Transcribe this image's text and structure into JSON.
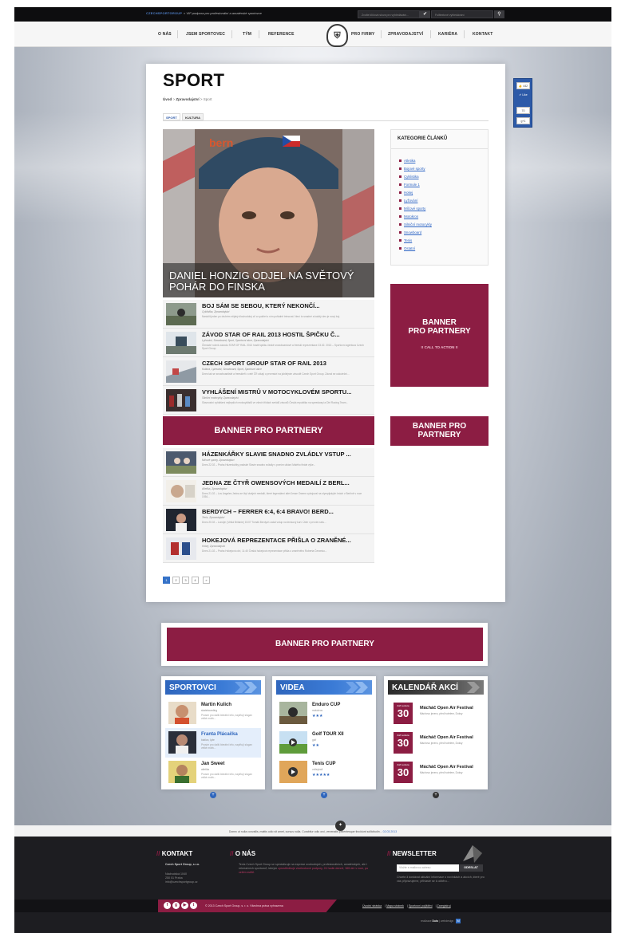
{
  "topbar": {
    "brand": "CZECHSPORTGROUP",
    "tagline": "» VIP podpora pro profesionální a amatérské sportovce",
    "search_placeholder": "Zvolte klíčová slova pro vyhledávání...",
    "search_placeholder2": "Fulltextové vyhledávání"
  },
  "nav": {
    "left": [
      "O NÁS",
      "JSEM SPORTOVEC",
      "TÝM",
      "REFERENCE"
    ],
    "right": [
      "PRO FIRMY",
      "ZPRAVODAJSTVÍ",
      "KARIÉRA",
      "KONTAKT"
    ]
  },
  "page": {
    "title": "SPORT",
    "breadcrumb": [
      "Úvod",
      "Zpravodajství",
      "Sport"
    ],
    "tabs": [
      "SPORT",
      "KULTURA"
    ]
  },
  "featured": {
    "title": "DANIEL HONZIG ODJEL NA SVĚTOVÝ POHÁR DO FINSKA"
  },
  "articles": [
    {
      "title": "BOJ SÁM SE SEBOU, KTERÝ NEKONČÍ...",
      "meta": "Cyklistika, Zpravodajství",
      "desc": "Nastolit jeden po druhém nějaký dlouhodobý cíl a vydržet s ním pořádně trénovat. Není to snadné a každý den je nový boj."
    },
    {
      "title": "ZÁVOD STAR OF RAIL 2013 HOSTIL ŠPIČKU Č...",
      "meta": "Lyžování, Snowboard, Sport, Sportovní akce, Zpravodajství",
      "desc": "Čtrnácté ročník závodu STAR OF RAIL 2013 hostil špičku české snowboardové a freeski reprezentace 23.02. 2013 – Sportovní agentura Czech Sport Group"
    },
    {
      "title": "CZECH SPORT GROUP STAR OF RAIL 2013",
      "meta": "Kultura, Lyžování, Snowboard, Sport, Sportovní akce",
      "desc": "Dnes tak se snowboardisté a freeskieři z celé ČR utkají o prvenství na jubilejním závodě Czech Sport Group. Závod se uskuteční..."
    },
    {
      "title": "VYHLÁŠENÍ MISTRŮ V MOTOCYKLOVÉM SPORTU...",
      "meta": "Silniční motocykly, Zpravodajství",
      "desc": "Slavnostní vyhlášení nejlepších motocyklistů ve všech třídách seriálů závodů Česká republika na speedwayi a Dirt Racing Team..."
    },
    {
      "title": "HÁZENKÁŘKY SLAVIE SNADNO ZVLÁDLY VSTUP ...",
      "meta": "Míčové sporty, Zpravodajství",
      "desc": "Dnes 22.02 – Praha Házenkářky pražské Slavie snadno zvládly v prvním utkání Malého finále výše..."
    },
    {
      "title": "JEDNA ZE ČTYŘ OWENSOVÝCH MEDAILÍ Z BERL...",
      "meta": "Atletika, Zpravodajství",
      "desc": "Dnes 21.02 – Los Angeles Jedna ze čtyř zlatých medailí, které legendární atlet Jesse Owens vybojoval na olympijských hrách v Berlíně v roce 1936..."
    },
    {
      "title": "BERDYCH – FERRER 6:4, 6:4 BRAVO! BERD...",
      "meta": "Tenis, Zpravodajství",
      "desc": "Dnes 20.02 – Londýn (Velká Británie) 15:07 Tomáš Berdych začal vstup na tenisový kurt. Úder v prvním setu..."
    },
    {
      "title": "HOKEJOVÁ REPREZENTACE PŘIŠLA O ZRANĚNÉ...",
      "meta": "Hokej, Zpravodajství",
      "desc": "Dnes 21.02 – Praha Hokejová ctví, 11:40 Česká hokejová reprezentace přišla o zraněného Roberta Čerwnku..."
    }
  ],
  "banners": {
    "wide": "BANNER PRO PARTNERY",
    "tall_line1": "BANNER",
    "tall_line2": "PRO PARTNERY",
    "tall_cta": "!! CALL TO ACTION !!",
    "small": "BANNER PRO PARTNERY",
    "bottom": "BANNER PRO PARTNERY"
  },
  "pagination": [
    "1",
    "2",
    "3",
    "4",
    "»"
  ],
  "categories": {
    "title": "KATEGORIE ČLÁNKŮ",
    "items": [
      "Atletika",
      "Bojové sporty",
      "Cyklistika",
      "Formule 1",
      "Hokej",
      "Lyžování",
      "Míčové sporty",
      "Motokros",
      "Silniční motocykly",
      "Snowboard",
      "Tenis",
      "Ostatní"
    ]
  },
  "share": {
    "like": "442",
    "like_label": "Like",
    "tweet_count": "70",
    "gplus": "g+1"
  },
  "sportovci": {
    "title": "SPORTOVCI",
    "items": [
      {
        "name": "Martin Kulich",
        "sub": "skateboarding",
        "desc": "Prosím pro další kterátní info, naplňují slogan velké motiv..."
      },
      {
        "name": "Franta Plácačka",
        "sub": "biatlon, lyže",
        "desc": "Prosím pro další kterátní info, naplňují slogan velké motiv..."
      },
      {
        "name": "Jan Sweet",
        "sub": "atletika",
        "desc": "Prosím pro další kterátní info, naplňují slogan velké motiv..."
      }
    ]
  },
  "videa": {
    "title": "VIDEA",
    "items": [
      {
        "name": "Enduro CUP",
        "sub": "motokros",
        "stars": "★★★"
      },
      {
        "name": "Golf TOUR XII",
        "sub": "golf",
        "stars": "★★"
      },
      {
        "name": "Tenis CUP",
        "sub": "volleyball",
        "stars": "★★★★★"
      }
    ]
  },
  "kalendar": {
    "title": "KALENDÁŘ AKCÍ",
    "items": [
      {
        "date_label": "Září sobota",
        "day": "30",
        "name": "Mácháč Open Air Festival",
        "sub": "Máchovo jezero, před hotelem, Doksy"
      },
      {
        "date_label": "Září sobota",
        "day": "30",
        "name": "Mácháč Open Air Festival",
        "sub": "Máchovo jezero, před hotelem, Doksy"
      },
      {
        "date_label": "Září sobota",
        "day": "30",
        "name": "Mácháč Open Air Festival",
        "sub": "Máchovo jezero, před hotelem, Doksy"
      }
    ]
  },
  "ticker": {
    "text": "Donec ut nulla convallis, mattis odio sit amet, cursus nulla. Curabitur odio orci, venenatis pellentesque tincidunt sollicitudin... ",
    "link": "02.03.2013"
  },
  "footer": {
    "kontakt_title": "KONTAKT",
    "company": "Czech Sport Group, s.r.o.",
    "address1": "Náchodská 1040",
    "address2": "250 01 Praha",
    "email": "info@czechsportgroup.cz",
    "onas_title": "O NÁS",
    "onas_text": "Tenis Czech Sport Group se specializuje na exprese svobodných, profesionálních, amatérských, ale i rekreačních sportovců, kterým",
    "onas_highlight": "zprostředkuje vícekrokové podpory, 24 hodin denně, 365 dní v roce, po celém světě.",
    "newsletter_title": "NEWSLETTER",
    "newsletter_placeholder": "Vložte e-mailovou adresu",
    "newsletter_button": "ODESLAT",
    "newsletter_note": "Chcete-li dostávat aktuální informace o novinkách a akcích, které pro vás připravujeme, přihlaste se k odběru...",
    "copyright": "© 2013 Czech Sport Group, s. r. o. Všechna práva vyhrazena",
    "links": [
      "Úvodní stránka",
      "Mapa stránek",
      "Sportovní pojištění",
      "Zaregistruj"
    ],
    "credit_prefix": "realizace",
    "credit_name": "Duto",
    "credit_suffix": "webdesign"
  }
}
